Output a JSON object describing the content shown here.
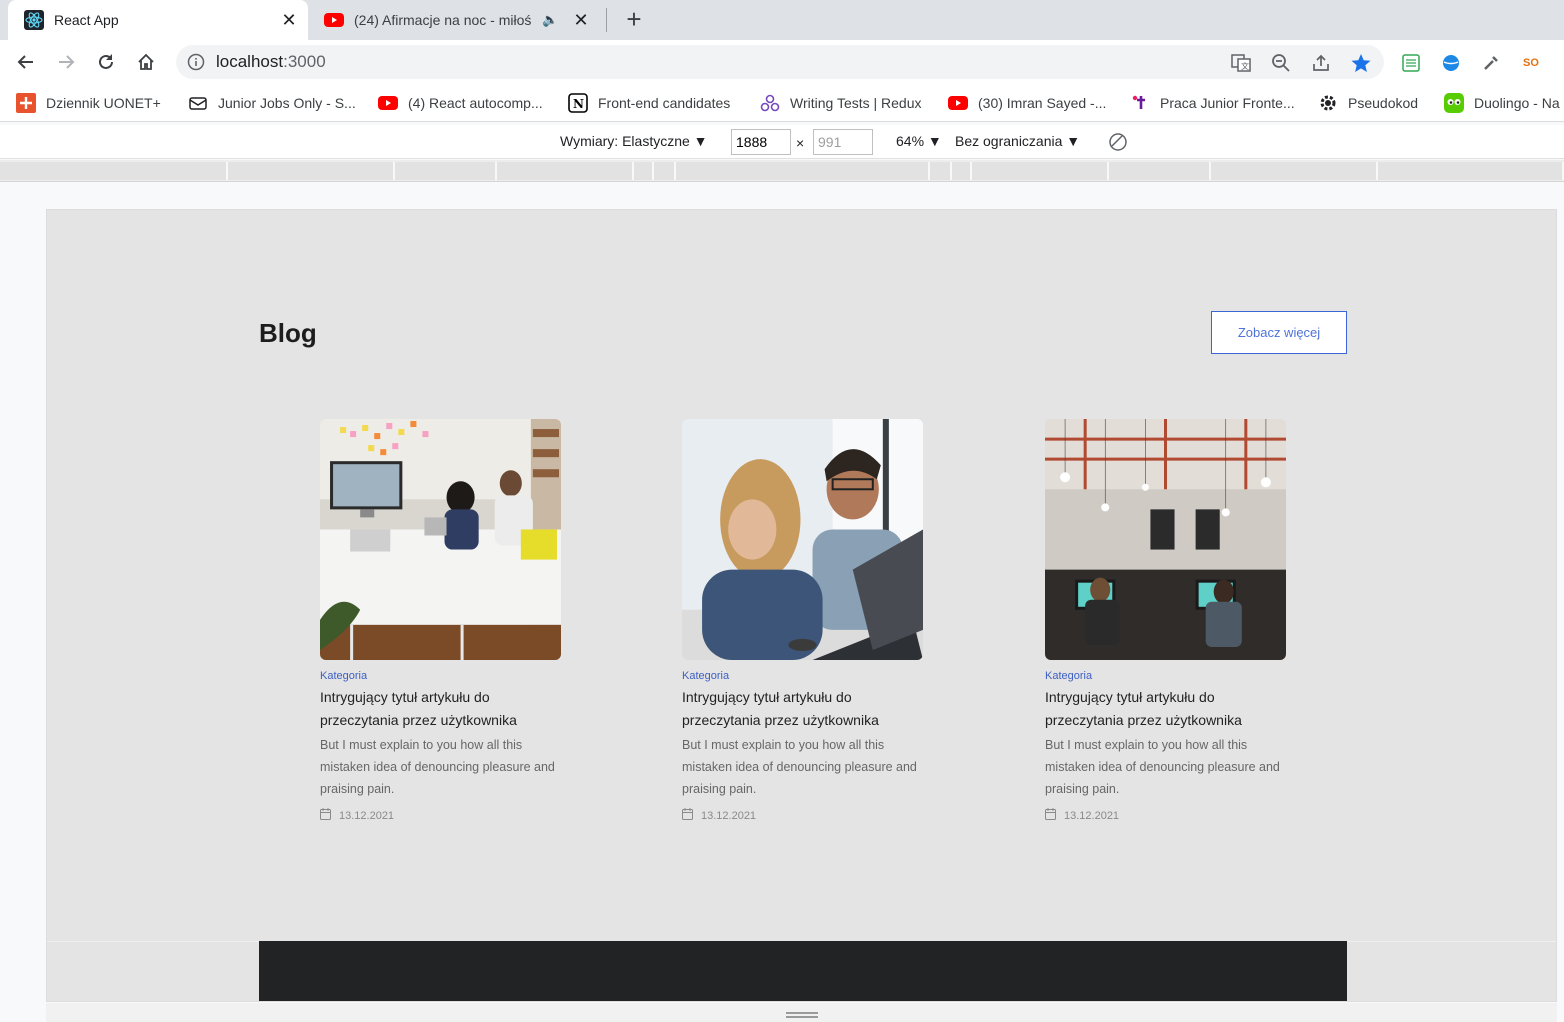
{
  "tabs": [
    {
      "title": "React App",
      "active": true
    },
    {
      "title": "(24) Afirmacje na noc - miłoś",
      "active": false
    }
  ],
  "address_bar": {
    "host": "localhost",
    "port": ":3000"
  },
  "bookmarks": [
    {
      "label": "Dziennik UONET+",
      "icon": "uonet-icon"
    },
    {
      "label": "Junior Jobs Only - S...",
      "icon": "envelope-icon"
    },
    {
      "label": "(4) React autocomp...",
      "icon": "youtube-icon"
    },
    {
      "label": "Front-end candidates",
      "icon": "notion-icon"
    },
    {
      "label": "Writing Tests | Redux",
      "icon": "redux-icon"
    },
    {
      "label": "(30) Imran Sayed -...",
      "icon": "youtube-icon"
    },
    {
      "label": "Praca Junior Fronte...",
      "icon": "justjoin-icon"
    },
    {
      "label": "Pseudokod",
      "icon": "gear-icon"
    },
    {
      "label": "Duolingo - Na",
      "icon": "duolingo-icon"
    }
  ],
  "device_toolbar": {
    "dimensions_label": "Wymiary: Elastyczne ▼",
    "width": "1888",
    "times": "×",
    "height": "991",
    "zoom": "64% ▼",
    "throttling": "Bez ograniczania ▼"
  },
  "page": {
    "section_title": "Blog",
    "see_more": "Zobacz więcej",
    "articles": [
      {
        "image": "office-meeting-photo",
        "category": "Kategoria",
        "title": "Intrygujący tytuł artykułu do przeczytania przez użytkownika",
        "excerpt": "But I must explain to you how all this mistaken idea of denouncing pleasure and praising pain.",
        "date": "13.12.2021"
      },
      {
        "image": "coworkers-laptop-photo",
        "category": "Kategoria",
        "title": "Intrygujący tytuł artykułu do przeczytania przez użytkownika",
        "excerpt": "But I must explain to you how all this mistaken idea of denouncing pleasure and praising pain.",
        "date": "13.12.2021"
      },
      {
        "image": "open-office-photo",
        "category": "Kategoria",
        "title": "Intrygujący tytuł artykułu do przeczytania przez użytkownika",
        "excerpt": "But I must explain to you how all this mistaken idea of denouncing pleasure and praising pain.",
        "date": "13.12.2021"
      }
    ]
  },
  "colors": {
    "accent_blue": "#3b66d6",
    "category_blue": "#3d5fc2",
    "viewport_bg": "#e4e4e4",
    "footer_dark": "#222324",
    "bookmark_star": "#1a73e8"
  }
}
